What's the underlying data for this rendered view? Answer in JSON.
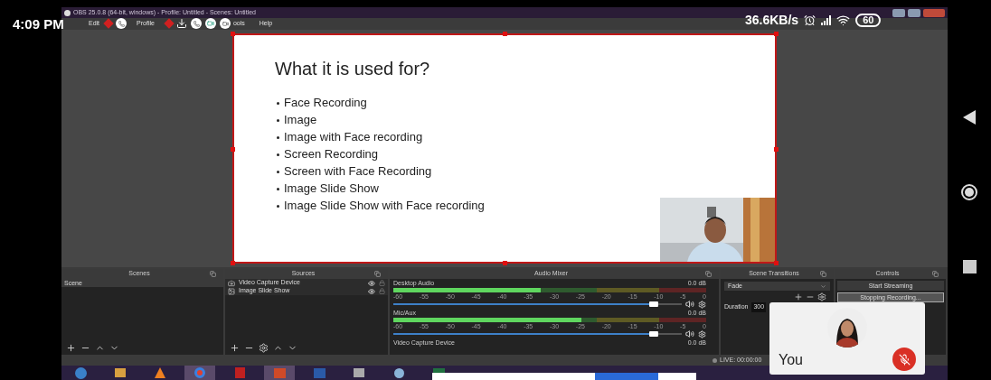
{
  "status_bar": {
    "time": "4:09 PM",
    "network_speed": "36.6KB/s",
    "battery": "60"
  },
  "window": {
    "title": "OBS 25.0.8 (64-bit, windows) - Profile: Untitled - Scenes: Untitled"
  },
  "menu": [
    "Edit",
    "Profile",
    "ools",
    "Help"
  ],
  "slide": {
    "title": "What it is used for?",
    "bullets": [
      "Face Recording",
      "Image",
      "Image with Face recording",
      "Screen Recording",
      "Screen with Face Recording",
      "Image Slide Show",
      "Image Slide Show with Face recording"
    ]
  },
  "scenes": {
    "title": "Scenes",
    "items": [
      {
        "label": "Scene",
        "selected": true
      }
    ]
  },
  "sources": {
    "title": "Sources",
    "items": [
      {
        "label": "Video Capture Device",
        "kind": "camera",
        "visible": true
      },
      {
        "label": "Image Slide Show",
        "kind": "slideshow",
        "visible": true
      }
    ]
  },
  "audio_mixer": {
    "title": "Audio Mixer",
    "channels": [
      {
        "name": "Desktop Audio",
        "reading": "0.0 dB",
        "meter": {
          "level": 0.47
        },
        "fader": {
          "level": 0.92
        },
        "scale": [
          "-60",
          "-55",
          "-50",
          "-45",
          "-40",
          "-35",
          "-30",
          "-25",
          "-20",
          "-15",
          "-10",
          "-5",
          "0"
        ]
      },
      {
        "name": "Mic/Aux",
        "reading": "0.0 dB",
        "meter": {
          "level": 0.6
        },
        "fader": {
          "level": 0.92
        },
        "scale": [
          "-60",
          "-55",
          "-50",
          "-45",
          "-40",
          "-35",
          "-30",
          "-25",
          "-20",
          "-15",
          "-10",
          "-5",
          "0"
        ]
      },
      {
        "name": "Video Capture Device",
        "reading": "0.0 dB"
      }
    ]
  },
  "scene_transitions": {
    "title": "Scene Transitions",
    "transition": "Fade",
    "duration_label": "Duration",
    "duration": "300"
  },
  "controls": {
    "title": "Controls",
    "buttons": [
      {
        "label": "Start Streaming",
        "focused": false
      },
      {
        "label": "Stopping Recording...",
        "focused": true
      }
    ]
  },
  "live": "LIVE: 00:00:00",
  "call_tile": {
    "name": "You",
    "muted": true
  }
}
